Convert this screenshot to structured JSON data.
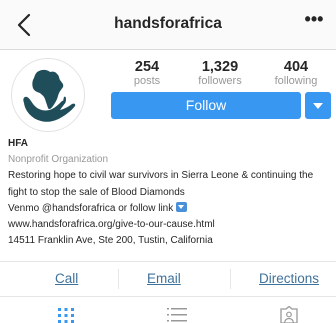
{
  "header": {
    "username": "handsforafrica",
    "back_icon": "chevron-left-icon",
    "more_label": "•••"
  },
  "stats": {
    "posts_count": "254",
    "posts_label": "posts",
    "followers_count": "1,329",
    "followers_label": "followers",
    "following_count": "404",
    "following_label": "following"
  },
  "follow": {
    "label": "Follow",
    "color": "#3897f0"
  },
  "bio": {
    "name": "HFA",
    "category": "Nonprofit Organization",
    "description": "Restoring hope to civil war survivors in Sierra Leone & continuing the fight to stop the sale of Blood Diamonds",
    "venmo_text": "Venmo @handsforafrica or follow link",
    "link_icon": "down-arrow-box-icon",
    "website": "www.handsforafrica.org/give-to-our-cause.html",
    "address": "14511 Franklin Ave, Ste 200, Tustin, California"
  },
  "contact_actions": {
    "call": "Call",
    "email": "Email",
    "directions": "Directions",
    "link_color": "#3f729b"
  },
  "tabs": [
    {
      "icon": "grid-icon",
      "active": true
    },
    {
      "icon": "list-icon",
      "active": false
    },
    {
      "icon": "tagged-person-icon",
      "active": false
    }
  ],
  "colors": {
    "logo_teal": "#1f4e5a",
    "active_tab": "#3897f0"
  }
}
